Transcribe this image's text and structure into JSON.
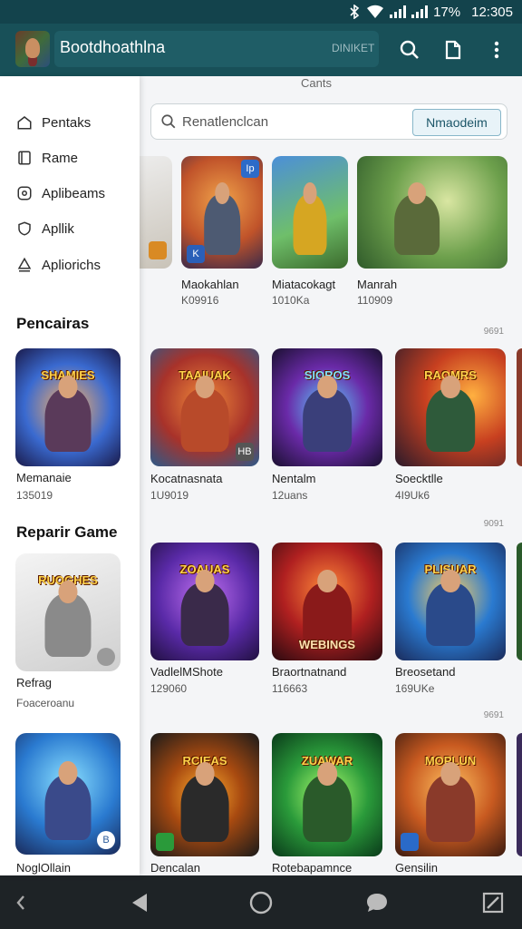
{
  "status": {
    "battery": "17%",
    "time": "12:305"
  },
  "appbar": {
    "title": "Bootdhoathlna",
    "hint": "DINIKET"
  },
  "content": {
    "tab_label": "Cants",
    "search": {
      "placeholder": "Renatlenclcan",
      "button": "Nmaodeim"
    },
    "row_tags": [
      "9691",
      "9091",
      "9691"
    ],
    "row1": [
      {
        "name": "Maokahlan",
        "sub": "K09916"
      },
      {
        "name": "Miatacokagt",
        "sub": "1010Ka"
      },
      {
        "name": "Manrah",
        "sub": "110909"
      }
    ],
    "row2": [
      {
        "name": "Kocatnasnata",
        "sub": "1U9019",
        "banner": "TAAIUAK"
      },
      {
        "name": "Nentalm",
        "sub": "12uans",
        "banner": "SIOROS"
      },
      {
        "name": "Soecktlle",
        "sub": "4I9Uk6",
        "banner": "RAOMRS"
      }
    ],
    "row3": [
      {
        "name": "VadlelMShote",
        "sub": "129060",
        "banner": "ZOAUAS"
      },
      {
        "name": "Braortnatnand",
        "sub": "116663",
        "banner": "WEBINGS"
      },
      {
        "name": "Breosetand",
        "sub": "169UKe",
        "banner": "PLISUAR"
      }
    ],
    "row4": [
      {
        "name": "Dencalan",
        "banner": "RCIEAS"
      },
      {
        "name": "Rotebapamnce",
        "banner": "ZUAWAR"
      },
      {
        "name": "Gensilin",
        "banner": "MOPLUN"
      }
    ]
  },
  "drawer": {
    "items": [
      {
        "label": "Pentaks",
        "icon": "home-icon"
      },
      {
        "label": "Rame",
        "icon": "book-icon"
      },
      {
        "label": "Aplibeams",
        "icon": "app-icon"
      },
      {
        "label": "Apllik",
        "icon": "shield-icon"
      },
      {
        "label": "Apliorichs",
        "icon": "person-icon"
      }
    ],
    "section1": {
      "title": "Pencairas",
      "card": {
        "name": "Memanaie",
        "sub": "135019",
        "banner": "SHAMIES"
      }
    },
    "section2": {
      "title": "Reparir Game",
      "card": {
        "name": "Refrag",
        "sub": "Foaceroanu",
        "banner": "RUOGHES"
      }
    },
    "card3": {
      "name": "NoglOllain"
    }
  }
}
